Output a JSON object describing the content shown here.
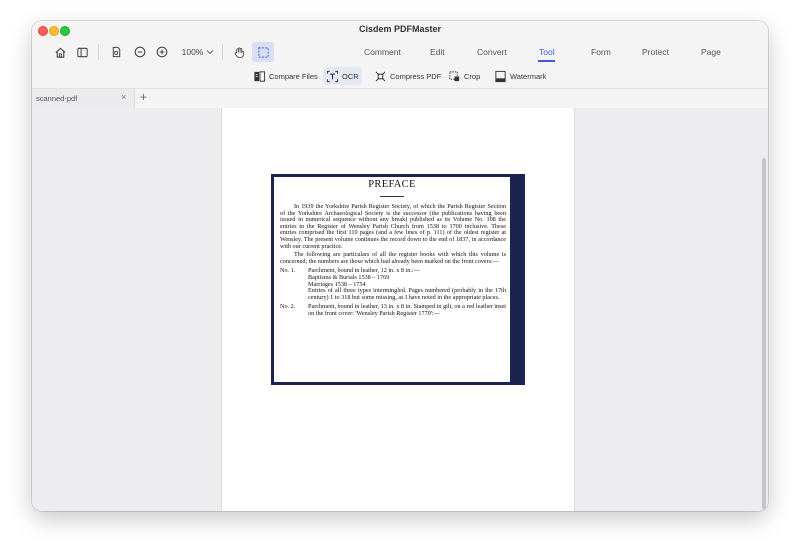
{
  "app": {
    "title": "Cisdem PDFMaster"
  },
  "toolbar": {
    "zoom_value": "100%",
    "tabs": [
      {
        "label": "Comment"
      },
      {
        "label": "Edit"
      },
      {
        "label": "Convert"
      },
      {
        "label": "Tool"
      },
      {
        "label": "Form"
      },
      {
        "label": "Protect"
      },
      {
        "label": "Page"
      }
    ],
    "active_tab": "Tool",
    "accent_color": "#3b5bdb"
  },
  "tool_bar": {
    "items": [
      {
        "label": "Compare Files",
        "icon": "compare-files-icon"
      },
      {
        "label": "OCR",
        "icon": "ocr-icon"
      },
      {
        "label": "Compress PDF",
        "icon": "compress-pdf-icon"
      },
      {
        "label": "Crop",
        "icon": "crop-icon"
      },
      {
        "label": "Watermark",
        "icon": "watermark-icon"
      }
    ],
    "active_item": "OCR"
  },
  "document_tab": {
    "label": "scanned-pdf",
    "close_glyph": "×",
    "add_glyph": "+"
  },
  "document": {
    "heading": "PREFACE",
    "paragraphs": [
      "In 1939 the Yorkshire Parish Register Society, of which the Parish Register Section of the Yorkshire Archaeological Society is the successor (the publications having been issued in numerical sequence without any break) published as its Volume No. 108 the entries in the Register of Wensley Parish Church from 1538 to 1700 inclusive. These entries comprised the first 110 pages (and a few lines of p. 111) of the oldest register at Wensley. The present volume continues the record down to the end of 1837, in accordance with our current practice.",
      "The following are particulars of all the register books with which this volume is concerned; the numbers are those which had already been marked on the front covers:—"
    ],
    "items": [
      {
        "number": "No. 1.",
        "lines": [
          "Parchment, bound in leather, 12 in. x 8 in.:—",
          "Baptisms & Burials 1538 – 1769",
          "Marriages                1538 – 1754",
          "Entries of all three types intermingled. Pages numbered (probably in the 17th century) 1 to 318 but some missing, as I have noted in the appropriate places."
        ]
      },
      {
        "number": "No. 2.",
        "lines": [
          "Parchment, bound in leather, 13 in. x 8 in. Stamped in gilt, on a red leather inset on the front cover: 'Wensley Parish Register 1770':—"
        ]
      }
    ]
  }
}
